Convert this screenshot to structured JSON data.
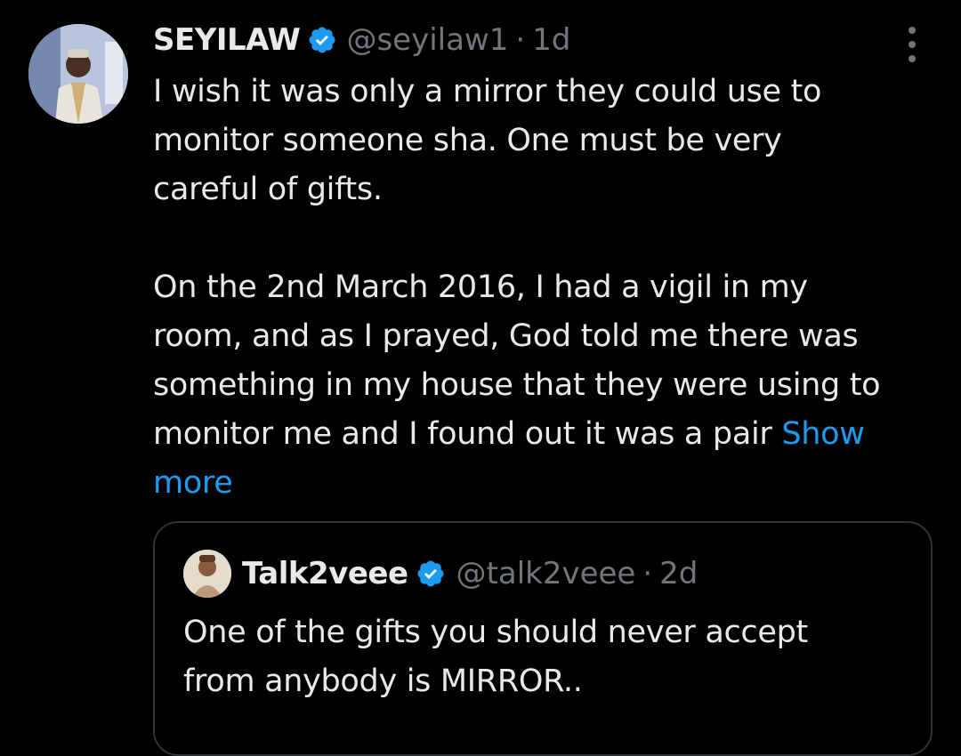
{
  "tweet": {
    "author": {
      "display_name": "SEYILAW",
      "handle": "@seyilaw1",
      "verified_icon": "verified-badge-icon",
      "avatar_icon": "avatar"
    },
    "separator": "·",
    "time": "1d",
    "more_icon": "more-options-icon",
    "text_lines": [
      "I wish it was only a mirror they could use to",
      "monitor someone sha. One must be very",
      "careful of gifts.",
      "",
      "On the 2nd March 2016, I had a vigil in my",
      "room, and as I prayed, God told me there was",
      "something in my house that they were using to",
      "monitor me and I found out it was a pair"
    ],
    "show_more_first": "Show",
    "show_more_second": "more"
  },
  "quoted_tweet": {
    "author": {
      "display_name": "Talk2veee",
      "handle": "@talk2veee",
      "verified_icon": "verified-badge-icon"
    },
    "separator": "·",
    "time": "2d",
    "text_lines": [
      "One of the gifts you should never accept",
      "from anybody is MIRROR.."
    ]
  },
  "colors": {
    "background": "#000000",
    "text_primary": "#e7e9ea",
    "text_secondary": "#71767b",
    "accent": "#1d9bf0",
    "border": "#2f3336"
  }
}
